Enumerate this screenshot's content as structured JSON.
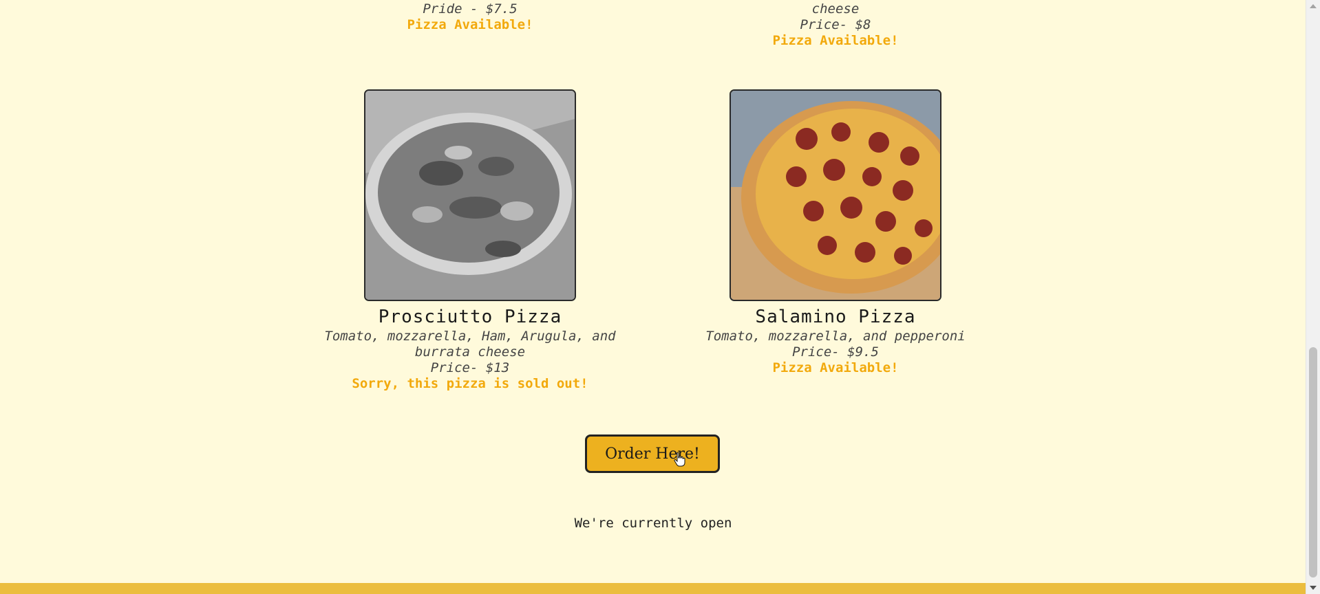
{
  "top_cards": [
    {
      "price": "Pride - $7.5",
      "status": "Pizza Available!"
    },
    {
      "ingredients_tail": "cheese",
      "price": "Price- $8",
      "status": "Pizza Available!"
    }
  ],
  "cards": [
    {
      "image": "prosciutto-pizza-photo-grayscale",
      "name": "Prosciutto Pizza",
      "ingredients": "Tomato, mozzarella, Ham, Arugula, and burrata cheese",
      "price": "Price- $13",
      "status": "Sorry, this pizza is sold out!"
    },
    {
      "image": "salamino-pizza-photo",
      "name": "Salamino Pizza",
      "ingredients": "Tomato, mozzarella, and pepperoni",
      "price": "Price- $9.5",
      "status": "Pizza Available!"
    }
  ],
  "order_button": {
    "label": "Order Here!"
  },
  "footer": {
    "open_text": "We're currently open"
  },
  "colors": {
    "background": "#fffadb",
    "accent": "#edb11f",
    "status": "#f2a90c"
  }
}
